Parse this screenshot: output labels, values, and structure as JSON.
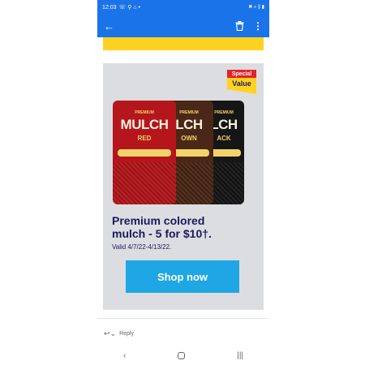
{
  "status_bar": {
    "time": "12:03",
    "left_icons": "☏ ⚲ ⌂ •",
    "right_icons": "✖ ⌕ ∥ ▮"
  },
  "app_bar": {
    "back_icon": "←",
    "more_icon": "⋮"
  },
  "ad": {
    "badge_top": "Special",
    "badge_bottom": "Value",
    "bags": [
      {
        "premium": "PREMIUM",
        "word": "MULCH",
        "color": "RED"
      },
      {
        "premium": "PREMIUM",
        "word": "LCH",
        "color": "OWN"
      },
      {
        "premium": "PREMIUM",
        "word": "LCH",
        "color": "ACK"
      }
    ],
    "headline_line1": "Premium colored",
    "headline_line2": "mulch - 5 for $10†.",
    "valid": "Valid 4/7/22-4/13/22.",
    "button": "Shop now"
  },
  "reply": {
    "icon": "↩︎⌄",
    "label": "Reply"
  },
  "nav": {
    "back": "‹",
    "recents": "|||"
  },
  "colors": {
    "app_bar": "#1a73e8",
    "brand_yellow": "#ffd21f",
    "cta": "#1ea7e4",
    "headline": "#1a1a5e"
  }
}
